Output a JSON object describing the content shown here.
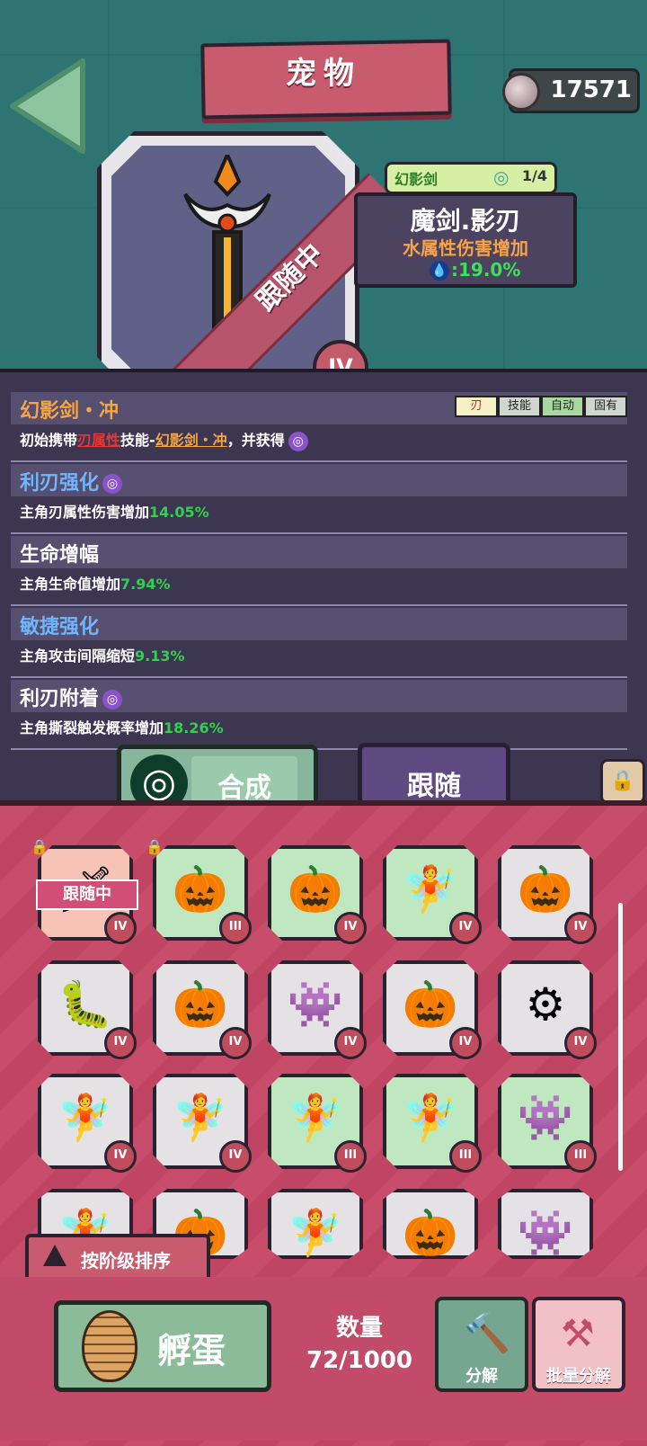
{
  "header": {
    "title": "宠物",
    "coins": "17571"
  },
  "pet": {
    "series_name": "幻影剑",
    "series_count": "1/4",
    "name": "魔剑.影刃",
    "attribute": "水属性伤害增加",
    "attribute_value": ":19.0%",
    "status_ribbon": "跟随中",
    "tier": "IV"
  },
  "skills": [
    {
      "title": "幻影剑・冲",
      "title_color": "#f5a446",
      "desc_prefix": "初始携带",
      "desc_em1": "刃属性",
      "desc_mid": "技能-",
      "desc_em2": "幻影剑・冲",
      "desc_suffix": "，并获得",
      "tags": [
        "刃",
        "技能",
        "自动",
        "固有"
      ]
    },
    {
      "title": "利刃强化",
      "title_color": "#6fb6ff",
      "desc": "主角刃属性伤害增加",
      "value": "14.05%"
    },
    {
      "title": "生命增幅",
      "title_color": "#ffffff",
      "desc": "主角生命值增加",
      "value": "7.94%"
    },
    {
      "title": "敏捷强化",
      "title_color": "#6fb6ff",
      "desc": "主角攻击间隔缩短",
      "value": "9.13%"
    },
    {
      "title": "利刃附着",
      "title_color": "#ffffff",
      "desc": "主角撕裂触发概率增加",
      "value": "18.26%"
    }
  ],
  "actions": {
    "combine": "合成",
    "follow": "跟随",
    "sort": "按阶级排序",
    "hatch": "孵蛋",
    "count_title": "数量",
    "count_value": "72/1000",
    "decompose": "分解",
    "batch_decompose": "批量分解"
  },
  "grid": {
    "following_flag": "跟随中",
    "cards": [
      {
        "kind": "sword",
        "tier": "IV",
        "bg": "pink",
        "lock": true,
        "following": true
      },
      {
        "kind": "pumpkin",
        "tier": "III",
        "bg": "green",
        "lock": true
      },
      {
        "kind": "pumpkin",
        "tier": "IV",
        "bg": "green"
      },
      {
        "kind": "fairy",
        "tier": "IV",
        "bg": "green"
      },
      {
        "kind": "pumpkin",
        "tier": "IV",
        "bg": "grey"
      },
      {
        "kind": "spring",
        "tier": "IV",
        "bg": "grey"
      },
      {
        "kind": "pumpkin",
        "tier": "IV",
        "bg": "grey"
      },
      {
        "kind": "purple",
        "tier": "IV",
        "bg": "grey"
      },
      {
        "kind": "pumpkin",
        "tier": "IV",
        "bg": "grey"
      },
      {
        "kind": "drone",
        "tier": "IV",
        "bg": "grey"
      },
      {
        "kind": "fairy",
        "tier": "IV",
        "bg": "grey"
      },
      {
        "kind": "fairy",
        "tier": "IV",
        "bg": "grey"
      },
      {
        "kind": "fairy",
        "tier": "III",
        "bg": "green"
      },
      {
        "kind": "fairy",
        "tier": "III",
        "bg": "green"
      },
      {
        "kind": "purple",
        "tier": "III",
        "bg": "green"
      },
      {
        "kind": "fairy",
        "tier": "",
        "bg": "grey"
      },
      {
        "kind": "pumpkin",
        "tier": "",
        "bg": "grey"
      },
      {
        "kind": "fairy",
        "tier": "",
        "bg": "grey"
      },
      {
        "kind": "pumpkin",
        "tier": "",
        "bg": "grey"
      },
      {
        "kind": "purple",
        "tier": "",
        "bg": "grey"
      }
    ]
  },
  "icons": {
    "sword": "🗡",
    "pumpkin": "🎃",
    "fairy": "🧚",
    "spring": "🐛",
    "purple": "👾",
    "drone": "⚙",
    "lock": "🔒",
    "swirl": "◎",
    "drop": "💧",
    "hammer": "🔨",
    "anvil": "⚒"
  }
}
